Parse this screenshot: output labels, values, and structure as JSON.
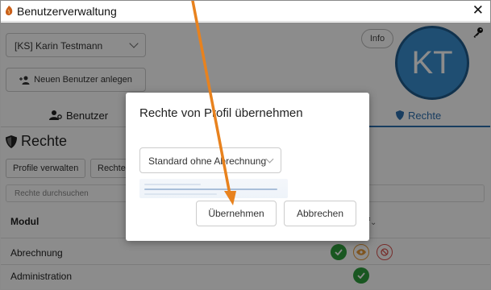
{
  "window": {
    "title": "Benutzerverwaltung",
    "close_symbol": "✕"
  },
  "header": {
    "user_select_value": "[KS] Karin Testmann",
    "new_user_button": "Neuen Benutzer anlegen",
    "info_button": "Info",
    "avatar_initials": "KT"
  },
  "tabs": {
    "users": "Benutzer",
    "rights": "Rechte"
  },
  "rights": {
    "section_title": "Rechte",
    "manage_profiles_button": "Profile verwalten",
    "second_button_partial": "Rechte",
    "search_placeholder": "Rechte durchsuchen",
    "col_module": "Modul",
    "col_right_partial": "f",
    "rows": [
      {
        "label": "Abrechnung"
      },
      {
        "label": "Administration"
      }
    ]
  },
  "modal": {
    "title": "Rechte von Profil übernehmen",
    "profile_value": "Standard ohne Abrechnung",
    "apply_button": "Übernehmen",
    "cancel_button": "Abbrechen"
  },
  "colors": {
    "accent_blue": "#2d6fb0",
    "avatar_blue": "#3a8fd0",
    "green": "#2f9e3c",
    "arrow_orange": "#e8821e"
  }
}
